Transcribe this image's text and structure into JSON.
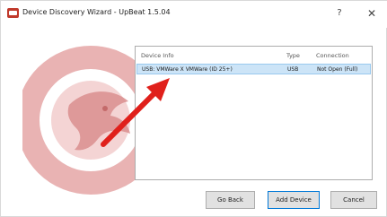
{
  "window": {
    "title": "Device Discovery Wizard - UpBeat 1.5.04",
    "help_glyph": "?",
    "close_glyph": "✕"
  },
  "device_list": {
    "columns": [
      "Device Info",
      "Type",
      "Connection"
    ],
    "rows": [
      {
        "info": "USB: VMWare X VMWare (ID 25+)",
        "type": "USB",
        "connection": "Not Open (Full)"
      }
    ]
  },
  "buttons": {
    "reset": "Go Back",
    "add": "Add Device",
    "cancel": "Cancel"
  },
  "colors": {
    "accent": "#c0392b",
    "logo_tint": "#e8b4b4",
    "arrow": "#e0201b",
    "selection": "#cce4f7"
  },
  "icons": {
    "app": "app-icon",
    "logo": "dragon-logo-icon",
    "pointer": "red-arrow-icon"
  }
}
